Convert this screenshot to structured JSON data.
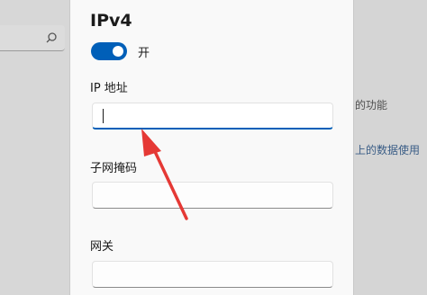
{
  "background": {
    "text1": "的功能",
    "text2": "上的数据使用"
  },
  "dialog": {
    "section_title": "IPv4",
    "toggle_state": "on",
    "toggle_label": "开",
    "fields": [
      {
        "label": "IP 地址",
        "value": "",
        "focused": true
      },
      {
        "label": "子网掩码",
        "value": "",
        "focused": false
      },
      {
        "label": "网关",
        "value": "",
        "focused": false
      }
    ]
  },
  "annotation": {
    "type": "red-arrow",
    "points_to": "ip-address-field"
  },
  "colors": {
    "accent": "#005fb8",
    "arrow": "#e53935",
    "dialog_bg": "#f9f9f9"
  }
}
